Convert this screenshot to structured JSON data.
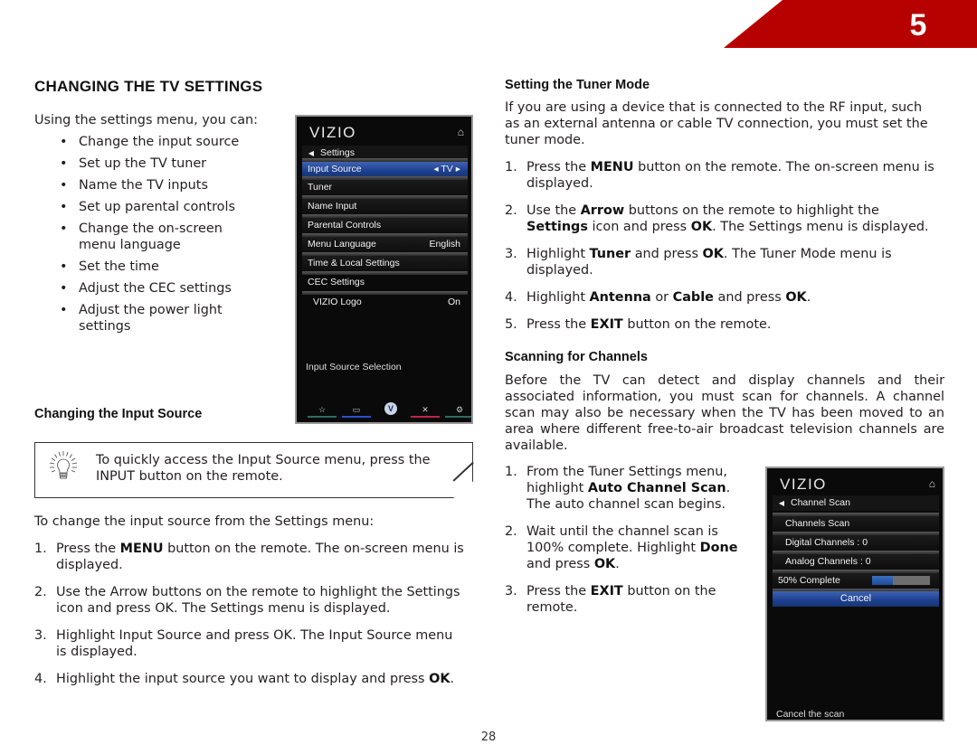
{
  "chapter": {
    "number": "5"
  },
  "section_title": "CHANGING THE TV SETTINGS",
  "intro": "Using the settings menu, you can:",
  "bullets": [
    "Change the input source",
    "Set up the TV tuner",
    "Name the TV inputs",
    "Set up parental controls",
    [
      "Change the on-screen",
      "menu language"
    ],
    "Set the time",
    "Adjust the CEC settings",
    [
      "Adjust the power light",
      "settings"
    ]
  ],
  "bullet_glyph": "•",
  "settings_menu": {
    "logo": "VIZIO",
    "home_icon": "⌂",
    "header": "Settings",
    "items": [
      {
        "label": "Input Source",
        "value": "◂ TV ▸",
        "selected": true
      },
      {
        "label": "Tuner",
        "value": ""
      },
      {
        "label": "Name Input",
        "value": ""
      },
      {
        "label": "Parental Controls",
        "value": ""
      },
      {
        "label": "Menu Language",
        "value": "English"
      },
      {
        "label": "Time & Local Settings",
        "value": ""
      },
      {
        "label": "CEC Settings",
        "value": ""
      },
      {
        "label": "VIZIO Logo",
        "value": "On"
      }
    ],
    "description": "Input Source Selection",
    "footer_icons": [
      {
        "name": "star",
        "glyph": "☆",
        "color": "#2e6b62"
      },
      {
        "name": "widescreen",
        "glyph": "▭",
        "color": "#2a4fd0"
      },
      {
        "name": "vizio-v",
        "glyph": "V",
        "color": ""
      },
      {
        "name": "close",
        "glyph": "✕",
        "color": "#c0234a"
      },
      {
        "name": "gear",
        "glyph": "⚙",
        "color": "#2e6b62"
      }
    ]
  },
  "changing_input": {
    "heading": "Changing the Input Source",
    "tip": [
      "To quickly access the Input Source menu, press the",
      "INPUT button on the remote."
    ],
    "lead": "To change the input source from the Settings menu:",
    "steps": [
      {
        "n": "1.",
        "parts": [
          [
            "Press the ",
            false
          ],
          [
            "MENU",
            true
          ],
          [
            " button on the remote. The on-screen menu is",
            false
          ]
        ],
        "line2": "displayed."
      },
      {
        "n": "2.",
        "parts": [
          [
            "Use the Arrow buttons on the remote to highlight the Settings",
            false
          ]
        ],
        "line2": "icon and press OK. The Settings menu is displayed."
      },
      {
        "n": "3.",
        "parts": [
          [
            "Highlight Input Source and press OK. The Input Source menu",
            false
          ]
        ],
        "line2": "is displayed."
      },
      {
        "n": "4.",
        "parts": [
          [
            "Highlight the input source you want to display and press ",
            false
          ],
          [
            "OK",
            true
          ],
          [
            ".",
            false
          ]
        ],
        "line2": ""
      }
    ]
  },
  "tuner_mode": {
    "heading": "Setting the Tuner Mode",
    "intro": [
      "If you are using a device that is connected to the RF input, such",
      "as an external antenna or cable TV connection, you must set the",
      "tuner mode."
    ],
    "steps": [
      {
        "n": "1.",
        "l1": [
          [
            "Press the ",
            false
          ],
          [
            "MENU",
            true
          ],
          [
            " button on the remote. The on-screen menu is",
            false
          ]
        ],
        "l2": [
          [
            "displayed.",
            false
          ]
        ]
      },
      {
        "n": "2.",
        "l1": [
          [
            "Use the ",
            false
          ],
          [
            "Arrow",
            true
          ],
          [
            " buttons on the remote to highlight the",
            false
          ]
        ],
        "l2": [
          [
            "Settings",
            true
          ],
          [
            " icon and press ",
            false
          ],
          [
            "OK",
            true
          ],
          [
            ". The Settings menu is displayed.",
            false
          ]
        ]
      },
      {
        "n": "3.",
        "l1": [
          [
            "Highlight ",
            false
          ],
          [
            "Tuner",
            true
          ],
          [
            " and press ",
            false
          ],
          [
            "OK",
            true
          ],
          [
            ". The Tuner Mode menu is",
            false
          ]
        ],
        "l2": [
          [
            "displayed.",
            false
          ]
        ]
      },
      {
        "n": "4.",
        "l1": [
          [
            "Highlight ",
            false
          ],
          [
            "Antenna",
            true
          ],
          [
            " or ",
            false
          ],
          [
            "Cable",
            true
          ],
          [
            " and press ",
            false
          ],
          [
            "OK",
            true
          ],
          [
            ".",
            false
          ]
        ],
        "l2": []
      },
      {
        "n": "5.",
        "l1": [
          [
            "Press the ",
            false
          ],
          [
            "EXIT",
            true
          ],
          [
            " button on the remote.",
            false
          ]
        ],
        "l2": []
      }
    ]
  },
  "scanning": {
    "heading": "Scanning for Channels",
    "intro": [
      "Before the TV can detect and display channels and their",
      "associated information, you must scan for channels. A channel",
      "scan may also be necessary when the TV has been moved to an",
      "area where different free-to-air broadcast television channels are",
      "available."
    ],
    "steps": [
      {
        "n": "1.",
        "lines": [
          [
            [
              "From the Tuner Settings menu,",
              false
            ]
          ],
          [
            [
              "highlight ",
              false
            ],
            [
              "Auto Channel Scan",
              true
            ],
            [
              ".",
              false
            ]
          ],
          [
            [
              "The auto channel scan begins.",
              false
            ]
          ]
        ]
      },
      {
        "n": "2.",
        "lines": [
          [
            [
              "Wait until the channel scan is",
              false
            ]
          ],
          [
            [
              "100% complete. Highlight ",
              false
            ],
            [
              "Done",
              true
            ]
          ],
          [
            [
              "and press ",
              false
            ],
            [
              "OK",
              true
            ],
            [
              ".",
              false
            ]
          ]
        ]
      },
      {
        "n": "3.",
        "lines": [
          [
            [
              "Press the ",
              false
            ],
            [
              "EXIT",
              true
            ],
            [
              " button on the",
              false
            ]
          ],
          [
            [
              "remote.",
              false
            ]
          ]
        ]
      }
    ]
  },
  "scan_menu": {
    "logo": "VIZIO",
    "home_icon": "⌂",
    "header": "Channel Scan",
    "rows": [
      "Channels Scan",
      "Digital Channels : 0",
      "Analog Channels : 0"
    ],
    "progress_label": "50% Complete",
    "progress_fraction": 0.5,
    "cancel_label": "Cancel",
    "description": "Cancel the scan"
  },
  "page_number": "28"
}
